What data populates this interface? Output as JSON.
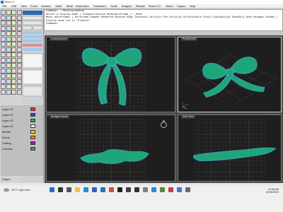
{
  "window": {
    "title": "Rhino 5"
  },
  "menu": [
    "File",
    "Edit",
    "View",
    "Curve",
    "Surface",
    "Solid",
    "Mesh",
    "Dimension",
    "Transform",
    "Tools",
    "Analyze",
    "Render",
    "Rhino 5.0",
    "Blend",
    "Clayoo",
    "Help"
  ],
  "command": {
    "lines": [
      "Command: _'SetDisplayMode",
      "Select a display mode ( Viewport=Active  Mode=Wireframe ): _Mode",
      "Mode <Wireframe> ( Wireframe  Shaded  Rendered  Ghosted  XRay  Technical  Artistic  Pen  ArtColor  ArtColorWire  Chalk  ClaycoSculpt  DemoOnly  Geno  Hexagon  Hidden )",
      "Display mode set to \"Plastic\"",
      "Command:"
    ]
  },
  "viewports": {
    "top": {
      "label": "Looking Down"
    },
    "perspective": {
      "label": "Perspective"
    },
    "front": {
      "label": "Straight Ahead"
    },
    "right": {
      "label": "Side View"
    }
  },
  "layers": [
    {
      "name": "Layer 01",
      "color": "#ff2a2a"
    },
    {
      "name": "Layer 02",
      "color": "#3a3aff"
    },
    {
      "name": "Layer 03",
      "color": "#2ab42a"
    },
    {
      "name": "Layer 04",
      "color": "#ffffff"
    },
    {
      "name": "Metals",
      "color": "#ffd400"
    },
    {
      "name": "Gems",
      "color": "#ff8a00"
    },
    {
      "name": "Cutting",
      "color": "#c800c8"
    },
    {
      "name": "Creation",
      "color": "#2ab42a"
    }
  ],
  "status": {
    "edges_label": "Edges"
  },
  "taskbar": {
    "weather": "30°C  Light rain",
    "time": "11:06 AM",
    "date": "02/08/2023",
    "apps": [
      "start-icon",
      "search-icon",
      "task-view-icon",
      "explorer-icon",
      "edge-icon",
      "store-icon",
      "mail-icon",
      "chrome-icon",
      "rhino-icon",
      "zbrush-icon",
      "terminal-icon",
      "settings-icon",
      "photos-icon",
      "app-icon",
      "app-icon-2",
      "app-icon-3",
      "app-icon-4"
    ]
  },
  "colors": {
    "gem": "#4fb0e6",
    "metal": "#1fa57a",
    "grid": "#3a3a3a",
    "grid_major": "#5a5a5a"
  }
}
